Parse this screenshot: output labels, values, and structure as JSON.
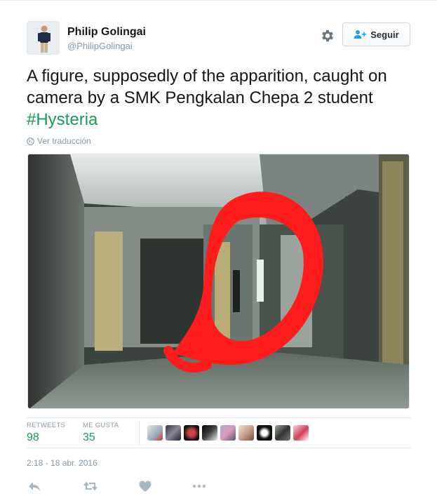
{
  "tweet": {
    "author_name": "Philip Golingai",
    "author_handle": "@PhilipGolingai",
    "follow_label": "Seguir",
    "text_main": "A figure, supposedly of the apparition, caught on camera by a SMK Pengkalan Chepa 2 student ",
    "hashtag": "#Hysteria",
    "translate_label": "Ver traducción",
    "timestamp": "2:18 - 18 abr. 2016"
  },
  "stats": {
    "retweets_label": "RETWEETS",
    "retweets_value": "98",
    "likes_label": "ME GUSTA",
    "likes_value": "35"
  },
  "icons": {
    "settings": "gear-icon",
    "follow": "add-user-icon",
    "translate": "globe-icon",
    "reply": "reply-icon",
    "retweet": "retweet-icon",
    "like": "heart-icon",
    "more": "more-dots-icon"
  },
  "colors": {
    "hashtag_green": "#1b9a58",
    "muted_gray": "#8899a6",
    "circle_red": "#ff1c1c"
  }
}
